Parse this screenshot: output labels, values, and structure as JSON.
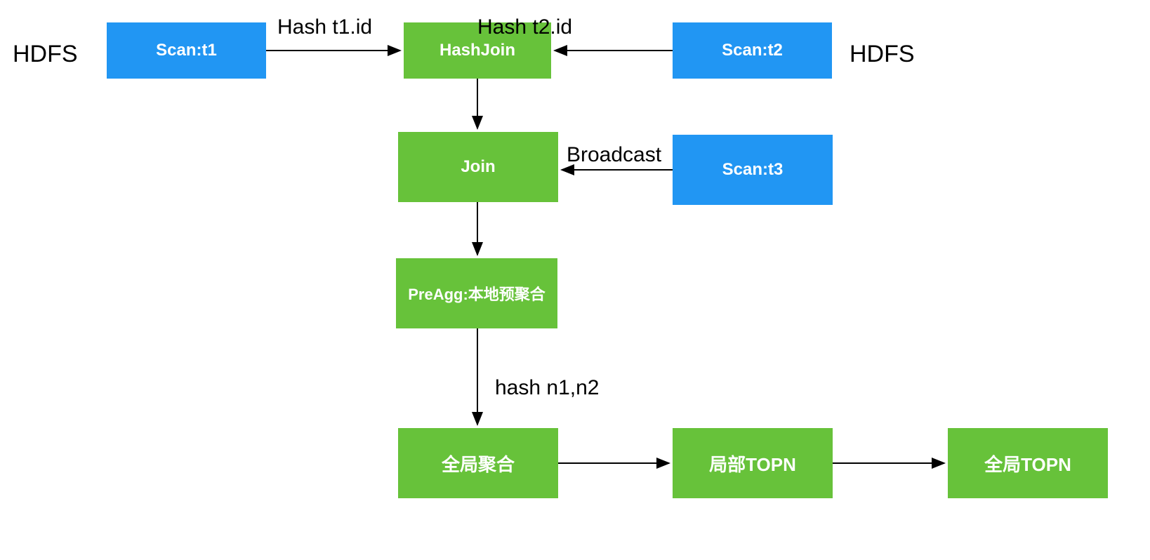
{
  "labels": {
    "hdfs_left": "HDFS",
    "hdfs_right": "HDFS"
  },
  "nodes": {
    "scan_t1": "Scan:t1",
    "hashjoin": "HashJoin",
    "scan_t2": "Scan:t2",
    "join": "Join",
    "scan_t3": "Scan:t3",
    "preagg": "PreAgg:本地预聚合",
    "globalagg": "全局聚合",
    "local_topn": "局部TOPN",
    "global_topn": "全局TOPN"
  },
  "edges": {
    "hash_t1_id": "Hash t1.id",
    "hash_t2_id": "Hash t2.id",
    "broadcast": "Broadcast",
    "hash_n1n2": "hash n1,n2"
  },
  "colors": {
    "blue": "#2196f3",
    "green": "#67c23a"
  }
}
